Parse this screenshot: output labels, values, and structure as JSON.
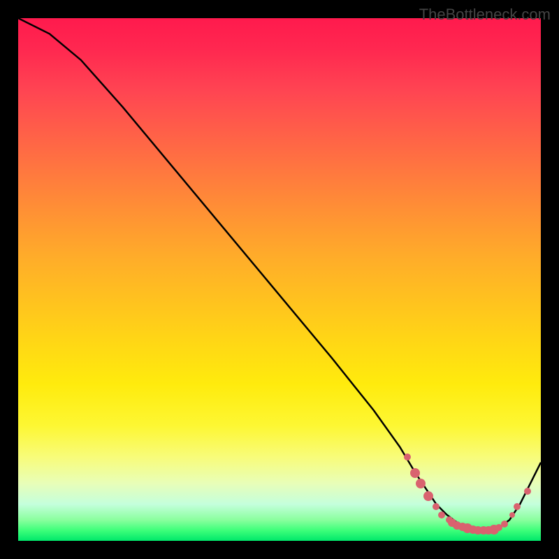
{
  "watermark": "TheBottleneck.com",
  "chart_data": {
    "type": "line",
    "title": "",
    "xlabel": "",
    "ylabel": "",
    "xlim": [
      0,
      100
    ],
    "ylim": [
      0,
      100
    ],
    "series": [
      {
        "name": "curve",
        "x": [
          0,
          6,
          12,
          20,
          30,
          40,
          50,
          60,
          68,
          73,
          76,
          78,
          80,
          82,
          84,
          86,
          88,
          90,
          92,
          94,
          96,
          100
        ],
        "y": [
          100,
          97,
          92,
          83,
          71,
          59,
          47,
          35,
          25,
          18,
          13,
          10,
          7,
          5,
          3.5,
          2.5,
          2,
          2,
          2.5,
          4,
          7,
          15
        ]
      }
    ],
    "markers": [
      {
        "x": 74.5,
        "y": 16,
        "r": 5
      },
      {
        "x": 76,
        "y": 13,
        "r": 7
      },
      {
        "x": 77,
        "y": 11,
        "r": 7
      },
      {
        "x": 78.5,
        "y": 8.5,
        "r": 7
      },
      {
        "x": 80,
        "y": 6.5,
        "r": 5
      },
      {
        "x": 81,
        "y": 5,
        "r": 5
      },
      {
        "x": 82.5,
        "y": 4,
        "r": 5
      },
      {
        "x": 83,
        "y": 3.5,
        "r": 6
      },
      {
        "x": 84,
        "y": 3,
        "r": 6
      },
      {
        "x": 85,
        "y": 2.7,
        "r": 6
      },
      {
        "x": 86,
        "y": 2.4,
        "r": 7
      },
      {
        "x": 87,
        "y": 2.2,
        "r": 6
      },
      {
        "x": 88,
        "y": 2,
        "r": 6
      },
      {
        "x": 89,
        "y": 2,
        "r": 6
      },
      {
        "x": 90,
        "y": 2,
        "r": 6
      },
      {
        "x": 91,
        "y": 2.1,
        "r": 7
      },
      {
        "x": 92,
        "y": 2.5,
        "r": 5
      },
      {
        "x": 93,
        "y": 3.2,
        "r": 5
      },
      {
        "x": 94.5,
        "y": 5,
        "r": 4
      },
      {
        "x": 95.5,
        "y": 6.5,
        "r": 5
      },
      {
        "x": 97.5,
        "y": 9.5,
        "r": 5
      }
    ]
  }
}
